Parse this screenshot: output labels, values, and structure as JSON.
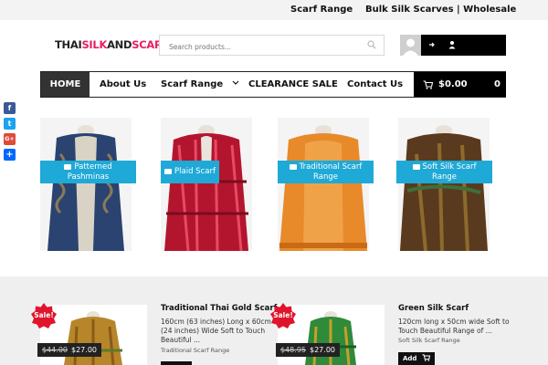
{
  "topbar": {
    "scarf_range": "Scarf Range",
    "bulk": "Bulk Silk Scarves | Wholesale"
  },
  "logo": {
    "part1": "THAI",
    "part2": "SILK",
    "part3": "AND",
    "part4": "SCARF"
  },
  "search": {
    "placeholder": "Search products..."
  },
  "nav": {
    "home": "HOME",
    "about": "About Us",
    "scarf_range": "Scarf Range",
    "clearance": "CLEARANCE SALE",
    "contact": "Contact Us",
    "cart_total": "$0.00",
    "cart_count": "0"
  },
  "social": [
    "f",
    "t",
    "G+",
    "+"
  ],
  "categories": [
    {
      "line1": "Patterned",
      "line2": "Pashminas"
    },
    {
      "line1": "Plaid Scarf",
      "line2": ""
    },
    {
      "line1": "Traditional Scarf",
      "line2": "Range"
    },
    {
      "line1": "Soft Silk Scarf",
      "line2": "Range"
    }
  ],
  "products": [
    {
      "sale": "Sale!",
      "old_price": "$44.00",
      "price": "$27.00",
      "title": "Traditional Thai Gold Scarf",
      "desc1": "160cm (63 inches) Long x 60cm",
      "desc2": "(24 inches) Wide Soft to Touch",
      "desc3": "Beautiful ...",
      "category": "Traditional Scarf Range"
    },
    {
      "sale": "Sale!",
      "old_price": "$48.95",
      "price": "$27.00",
      "title": "Green Silk Scarf",
      "desc1": "120cm long x 50cm wide Soft to",
      "desc2": "Touch Beautiful Range of ...",
      "desc3": "",
      "category": "Soft Silk Scarf Range",
      "add": "Add"
    }
  ],
  "colors": {
    "accent": "#1fa9d6",
    "sale": "#e0142c",
    "brand_pink": "#e91e63"
  }
}
